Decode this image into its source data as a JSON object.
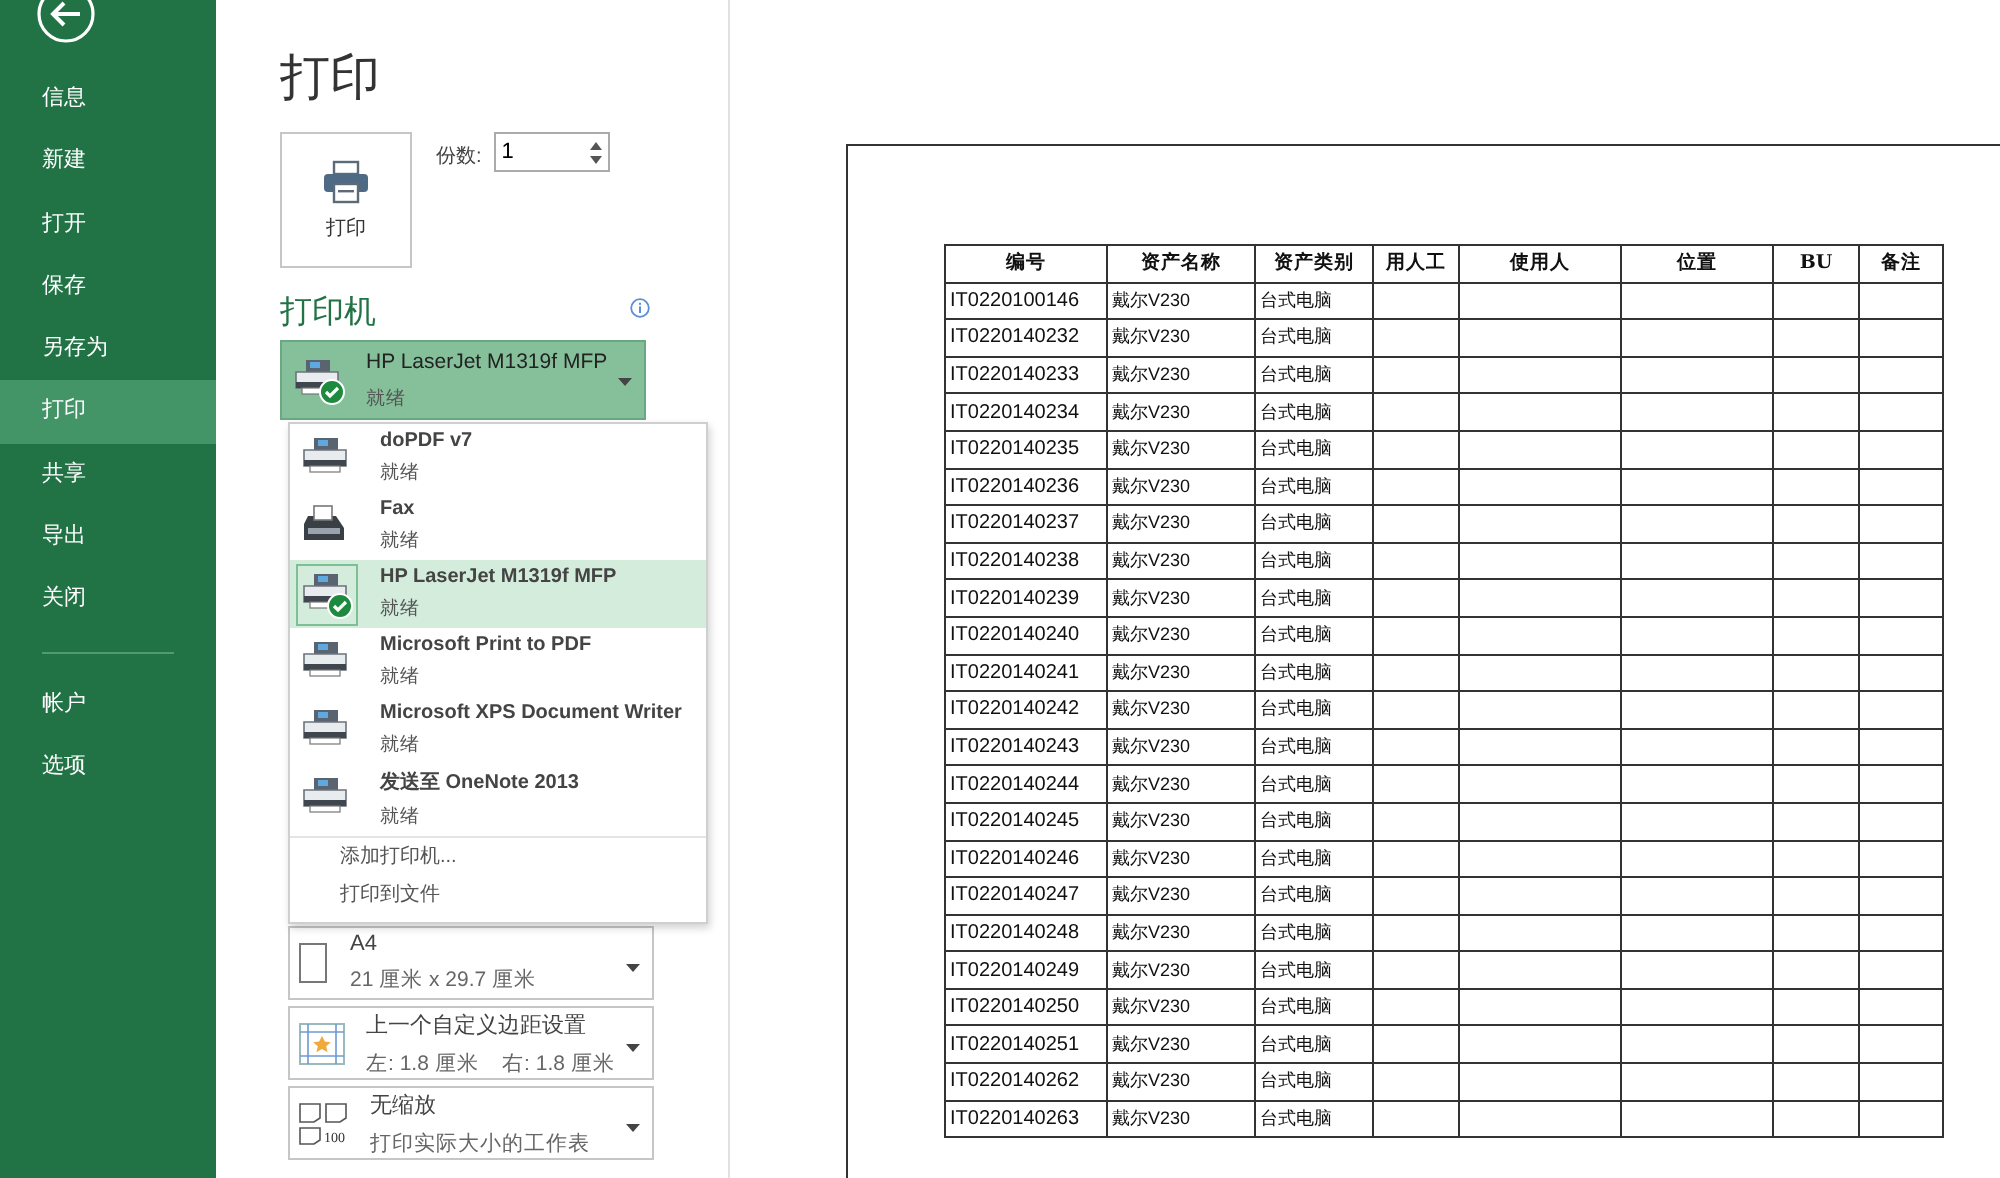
{
  "sidebar": {
    "items": [
      {
        "label": "信息",
        "selected": false
      },
      {
        "label": "新建",
        "selected": false
      },
      {
        "label": "打开",
        "selected": false
      },
      {
        "label": "保存",
        "selected": false
      },
      {
        "label": "另存为",
        "selected": false
      },
      {
        "label": "打印",
        "selected": true
      },
      {
        "label": "共享",
        "selected": false
      },
      {
        "label": "导出",
        "selected": false
      },
      {
        "label": "关闭",
        "selected": false
      },
      {
        "label": "帐户",
        "selected": false,
        "kind": "after_divider"
      },
      {
        "label": "选项",
        "selected": false
      }
    ]
  },
  "title": "打印",
  "print_button": {
    "label": "打印"
  },
  "copies": {
    "label": "份数:",
    "value": "1"
  },
  "printer": {
    "heading": "打印机",
    "name": "HP LaserJet M1319f MFP",
    "status": "就绪"
  },
  "printer_menu": {
    "printers": [
      {
        "name": "doPDF v7",
        "status": "就绪",
        "kind": "printer",
        "selected": false,
        "default": false
      },
      {
        "name": "Fax",
        "status": "就绪",
        "kind": "fax",
        "selected": false,
        "default": false
      },
      {
        "name": "HP LaserJet M1319f MFP",
        "status": "就绪",
        "kind": "printer",
        "selected": true,
        "default": true
      },
      {
        "name": "Microsoft Print to PDF",
        "status": "就绪",
        "kind": "printer",
        "selected": false,
        "default": false
      },
      {
        "name": "Microsoft XPS Document Writer",
        "status": "就绪",
        "kind": "printer",
        "selected": false,
        "default": false
      },
      {
        "name": "发送至 OneNote 2013",
        "status": "就绪",
        "kind": "printer",
        "selected": false,
        "default": false
      }
    ],
    "actions": [
      "添加打印机...",
      "打印到文件"
    ]
  },
  "settings": [
    {
      "kind": "paper",
      "title": "A4",
      "subtitle": "21 厘米 x 29.7 厘米"
    },
    {
      "kind": "margins",
      "title": "上一个自定义边距设置",
      "subtitle": "左: 1.8 厘米    右: 1.8 厘米"
    },
    {
      "kind": "scaling",
      "title": "无缩放",
      "subtitle": "打印实际大小的工作表",
      "icon_text": "100"
    }
  ],
  "preview": {
    "table": {
      "columns": [
        "编号",
        "资产名称",
        "资产类别",
        "用人工",
        "使用人",
        "位置",
        "BU",
        "备注"
      ],
      "rows": [
        [
          "IT0220100146",
          "戴尔V230",
          "台式电脑"
        ],
        [
          "IT0220140232",
          "戴尔V230",
          "台式电脑"
        ],
        [
          "IT0220140233",
          "戴尔V230",
          "台式电脑"
        ],
        [
          "IT0220140234",
          "戴尔V230",
          "台式电脑"
        ],
        [
          "IT0220140235",
          "戴尔V230",
          "台式电脑"
        ],
        [
          "IT0220140236",
          "戴尔V230",
          "台式电脑"
        ],
        [
          "IT0220140237",
          "戴尔V230",
          "台式电脑"
        ],
        [
          "IT0220140238",
          "戴尔V230",
          "台式电脑"
        ],
        [
          "IT0220140239",
          "戴尔V230",
          "台式电脑"
        ],
        [
          "IT0220140240",
          "戴尔V230",
          "台式电脑"
        ],
        [
          "IT0220140241",
          "戴尔V230",
          "台式电脑"
        ],
        [
          "IT0220140242",
          "戴尔V230",
          "台式电脑"
        ],
        [
          "IT0220140243",
          "戴尔V230",
          "台式电脑"
        ],
        [
          "IT0220140244",
          "戴尔V230",
          "台式电脑"
        ],
        [
          "IT0220140245",
          "戴尔V230",
          "台式电脑"
        ],
        [
          "IT0220140246",
          "戴尔V230",
          "台式电脑"
        ],
        [
          "IT0220140247",
          "戴尔V230",
          "台式电脑"
        ],
        [
          "IT0220140248",
          "戴尔V230",
          "台式电脑"
        ],
        [
          "IT0220140249",
          "戴尔V230",
          "台式电脑"
        ],
        [
          "IT0220140250",
          "戴尔V230",
          "台式电脑"
        ],
        [
          "IT0220140251",
          "戴尔V230",
          "台式电脑"
        ],
        [
          "IT0220140262",
          "戴尔V230",
          "台式电脑"
        ],
        [
          "IT0220140263",
          "戴尔V230",
          "台式电脑"
        ]
      ]
    }
  }
}
